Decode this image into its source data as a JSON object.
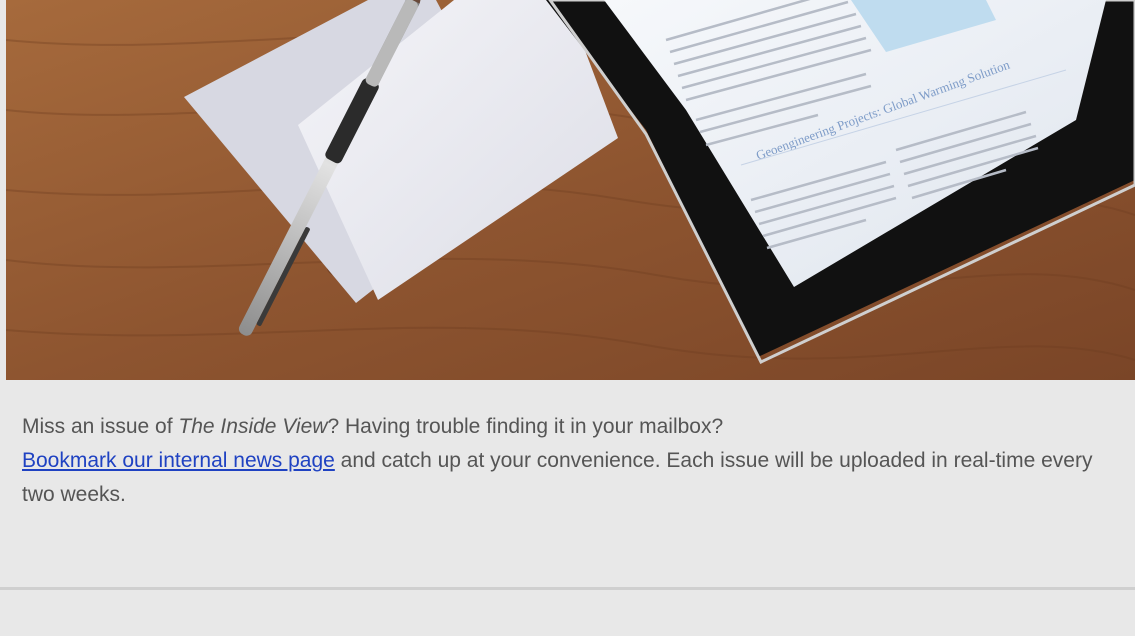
{
  "hero": {
    "image": "desk-tablet-pen-photo",
    "tablet_heading": "Geoengineering Projects: Global Warming Solution"
  },
  "intro": {
    "text_1": "Miss an issue of ",
    "publication": "The Inside View",
    "text_2": "? Having trouble finding it in your mailbox?",
    "link_label": "Bookmark our internal news page",
    "text_3": " and catch up at your convenience. Each issue will be uploaded in real-time every two weeks."
  },
  "colors": {
    "background": "#e8e8e8",
    "text": "#555555",
    "link": "#1f42c2",
    "divider": "#cfcfcf"
  }
}
